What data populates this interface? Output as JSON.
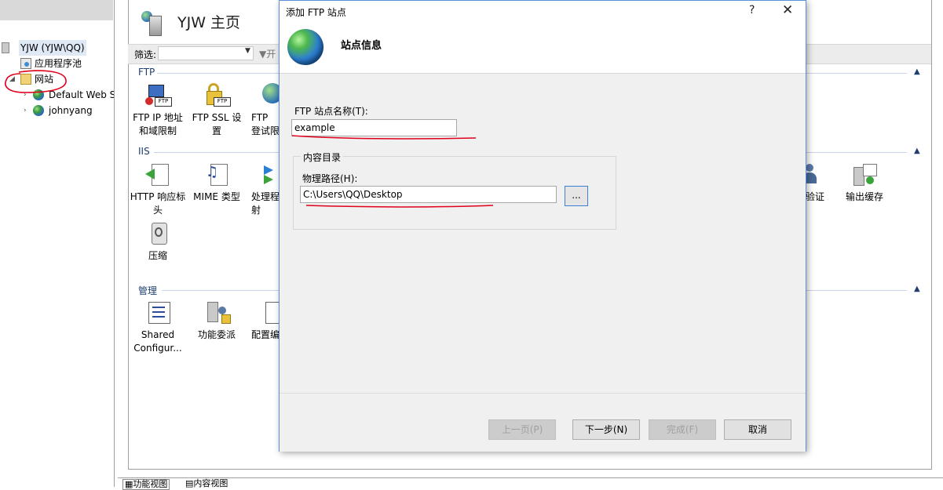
{
  "tree": {
    "server": "YJW (YJW\\QQ)",
    "app_pools": "应用程序池",
    "sites": "网站",
    "site_default": "Default Web S",
    "site_john": "johnyang"
  },
  "main": {
    "title": "YJW 主页",
    "filter_label": "筛选:",
    "filter_go": "开",
    "sections": {
      "ftp": "FTP",
      "iis": "IIS",
      "manage": "管理"
    },
    "tiles": {
      "ftp_ip": "FTP IP 地址和域限制",
      "ftp_ssl": "FTP SSL 设置",
      "ftp_login": "FTP 登试限",
      "http_headers": "HTTP 响应标头",
      "mime": "MIME 类型",
      "handler": "处理程射",
      "compress": "压缩",
      "auth": "验证",
      "output_cache": "输出缓存",
      "shared_config": "Shared Configur...",
      "delegation": "功能委派",
      "config_editor": "配置编"
    },
    "bottom_tabs": {
      "features": "功能视图",
      "content": "内容视图"
    }
  },
  "dialog": {
    "title": "添加 FTP 站点",
    "help": "?",
    "close": "✕",
    "heading": "站点信息",
    "site_name_label": "FTP 站点名称(T):",
    "site_name_value": "example",
    "content_dir_label": "内容目录",
    "physical_path_label": "物理路径(H):",
    "physical_path_value": "C:\\Users\\QQ\\Desktop",
    "browse": "...",
    "buttons": {
      "prev": "上一页(P)",
      "next": "下一步(N)",
      "finish": "完成(F)",
      "cancel": "取消"
    }
  },
  "colors": {
    "section_title": "#1e3e70",
    "dialog_border": "#5b8fd6",
    "annotation_red": "#e0001b"
  }
}
